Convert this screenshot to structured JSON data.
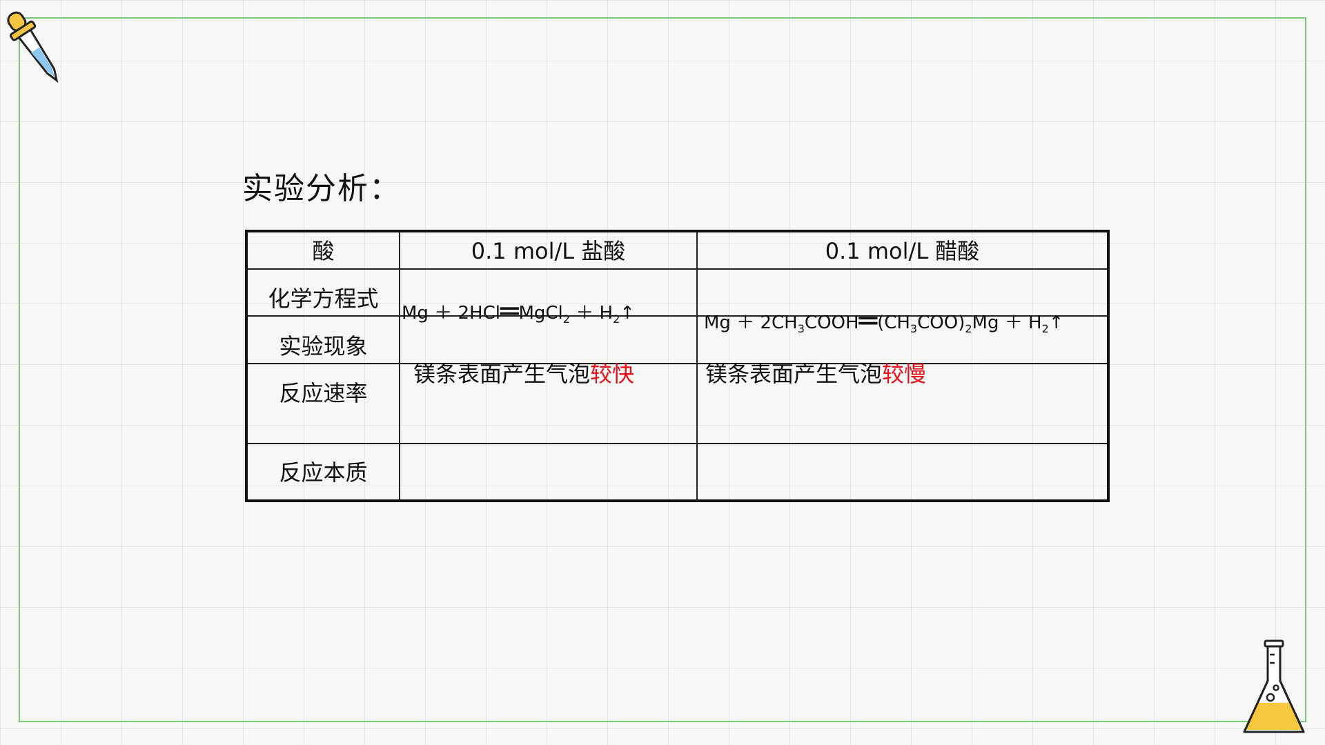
{
  "heading": "实验分析：",
  "table": {
    "header": {
      "col0": "酸",
      "col1": "0.1 mol/L  盐酸",
      "col2": "0.1 mol/L  醋酸"
    },
    "row_labels": {
      "equation": "化学方程式",
      "phenomenon": "实验现象",
      "rate": "反应速率",
      "essence": "反应本质"
    },
    "hcl_equation": {
      "mg": "Mg",
      "plus1": "＋",
      "reactant": "2HCl",
      "equals": "═",
      "product_base": "MgCl",
      "product_sub": "2",
      "plus2": "＋",
      "h": "H",
      "h_sub": "2",
      "arrow": "↑"
    },
    "acetic_equation": {
      "mg": "Mg",
      "plus1": "＋",
      "reactant_a": "2CH",
      "reactant_sub": "3",
      "reactant_b": "COOH",
      "equals": "═",
      "product_a": "(CH",
      "product_sub1": "3",
      "product_b": "COO)",
      "product_sub2": "2",
      "product_c": "Mg",
      "plus2": "＋",
      "h": "H",
      "h_sub": "2",
      "arrow": "↑"
    },
    "phenomenon_hcl": {
      "prefix": "镁条表面产生气泡",
      "highlight": "较快"
    },
    "phenomenon_acetic": {
      "prefix": "镁条表面产生气泡",
      "highlight": "较慢"
    }
  },
  "colors": {
    "highlight": "#e8111a",
    "frame": "#7cc67c",
    "grid": "#e4e4e1"
  },
  "icons": [
    "dropper-icon",
    "flask-icon"
  ]
}
